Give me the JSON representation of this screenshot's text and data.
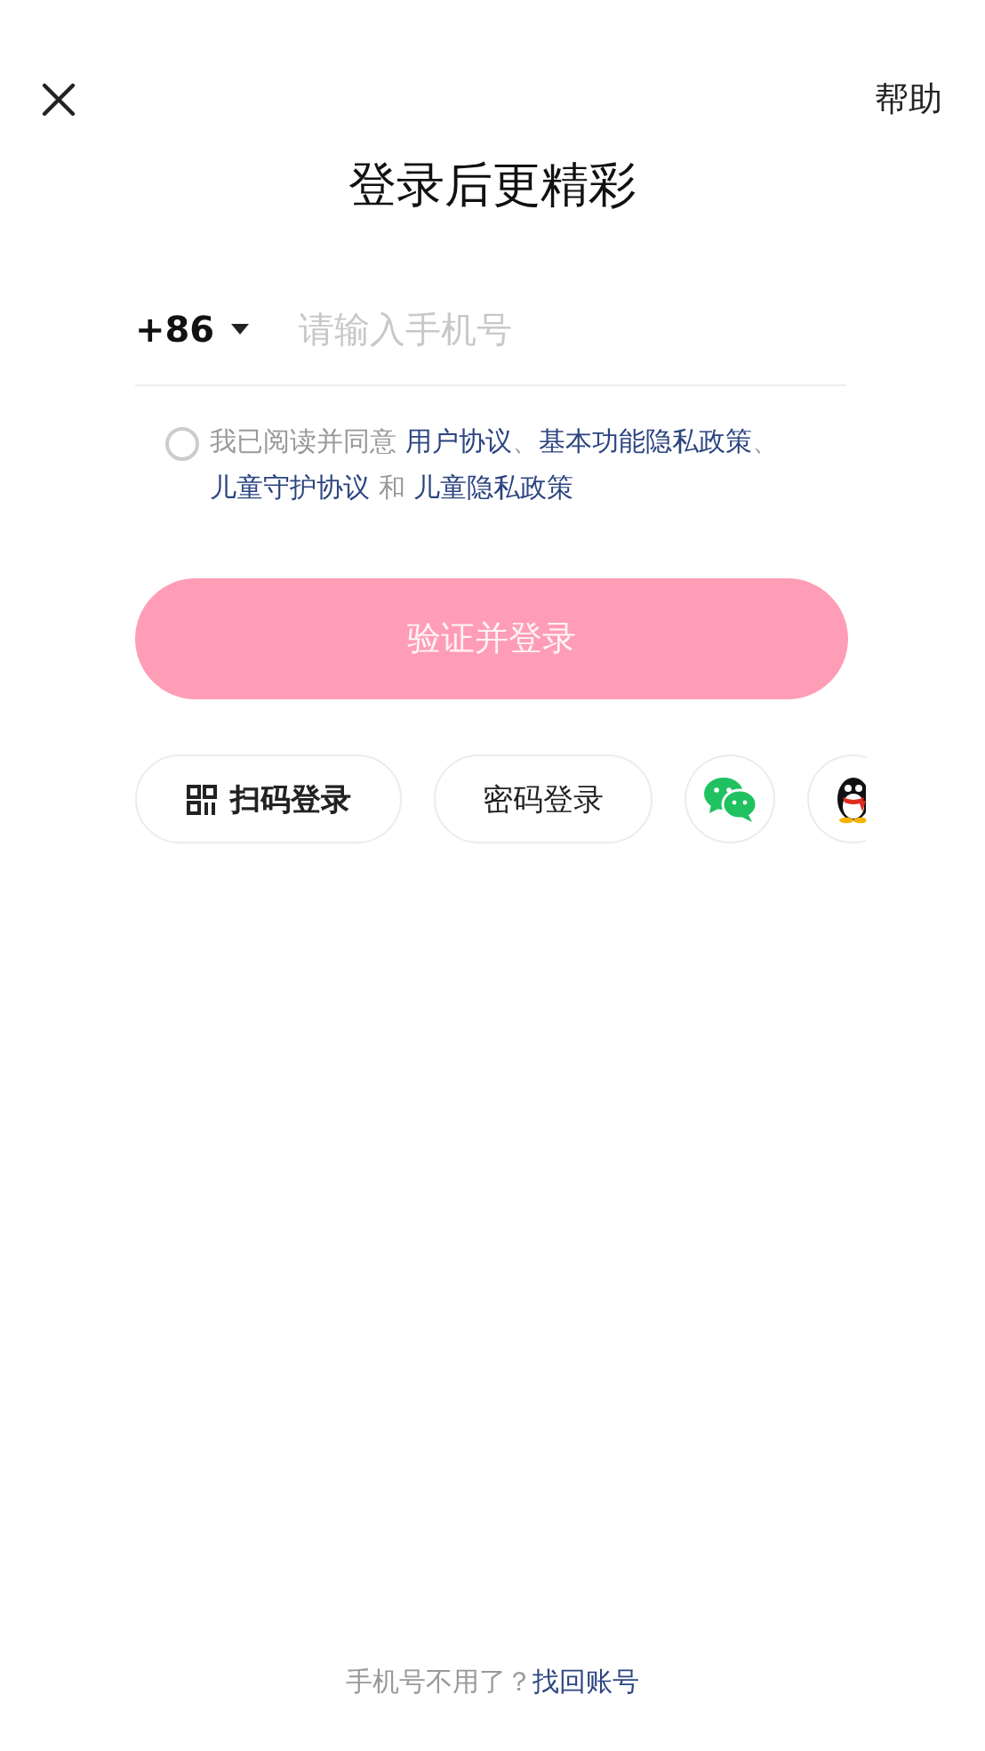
{
  "header": {
    "help": "帮助"
  },
  "title": "登录后更精彩",
  "phone": {
    "country_code": "+86",
    "placeholder": "请输入手机号"
  },
  "agreement": {
    "checked": false,
    "segments": [
      {
        "text": "我已阅读并同意 ",
        "kind": "plain"
      },
      {
        "text": "用户协议",
        "kind": "link"
      },
      {
        "text": "、",
        "kind": "plain"
      },
      {
        "text": "基本功能隐私政策",
        "kind": "link"
      },
      {
        "text": "、",
        "kind": "plain"
      },
      {
        "text": "儿童守护协议",
        "kind": "link"
      },
      {
        "text": " 和 ",
        "kind": "plain"
      },
      {
        "text": "儿童隐私政策",
        "kind": "link"
      }
    ]
  },
  "login_button": {
    "label": "验证并登录",
    "disabled": true
  },
  "alt_logins": [
    {
      "kind": "qr",
      "label": "扫码登录"
    },
    {
      "kind": "password",
      "label": "密码登录"
    },
    {
      "kind": "wechat"
    },
    {
      "kind": "qq"
    }
  ],
  "footer": {
    "question": "手机号不用了？",
    "link": "找回账号"
  }
}
